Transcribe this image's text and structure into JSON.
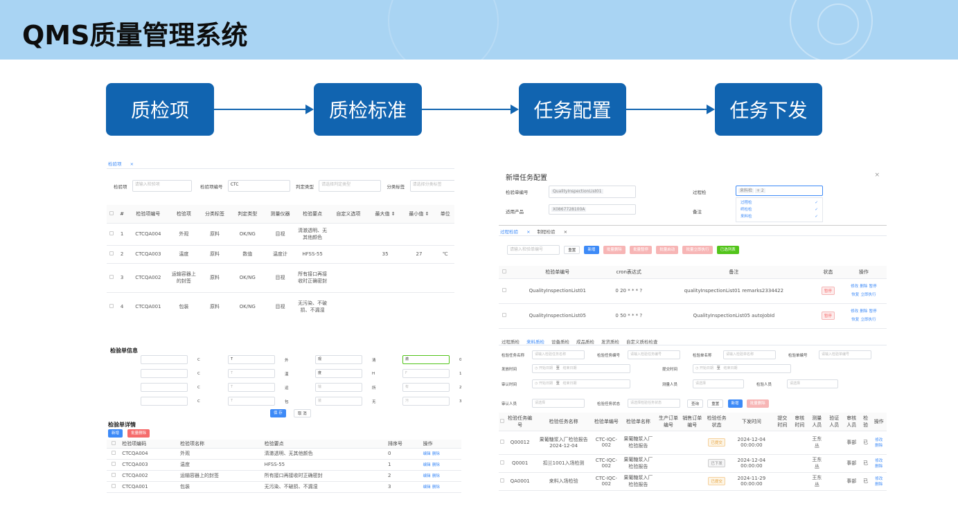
{
  "title": "QMS质量管理系统",
  "flow": [
    "质检项",
    "质检标准",
    "任务配置",
    "任务下发"
  ],
  "s1": {
    "tab": "检验项",
    "close": "×",
    "labels": [
      "检验项",
      "检验项编号",
      "判定类型",
      "分类标签"
    ],
    "placeholders": [
      "请输入检验项",
      "",
      "请选择判定类型",
      "请选择分类标签"
    ],
    "code_val": "CTC",
    "headers": [
      "",
      "#",
      "检验项编号",
      "检验项",
      "分类标签",
      "判定类型",
      "测量仪器",
      "检验要点",
      "自定义选项",
      "最大值 ⇕",
      "最小值 ⇕",
      "单位"
    ],
    "rows": [
      [
        "",
        "1",
        "CTCQA004",
        "外观",
        "原料",
        "OK/NG",
        "目视",
        "清澈透明、无其他颜色",
        "",
        "",
        "",
        ""
      ],
      [
        "",
        "2",
        "CTCQA003",
        "温度",
        "原料",
        "数值",
        "温度计",
        "HFSS-55",
        "",
        "35",
        "27",
        "℃"
      ],
      [
        "",
        "3",
        "CTCQA002",
        "运输容器上的封签",
        "原料",
        "OK/NG",
        "目视",
        "所有接口再接收时正确密封",
        "",
        "",
        "",
        ""
      ],
      [
        "",
        "4",
        "CTCQA001",
        "包装",
        "原料",
        "OK/NG",
        "目视",
        "无污染、不破损、不漏湿",
        "",
        "",
        "",
        ""
      ]
    ]
  },
  "s2": {
    "title": "新增任务配置",
    "close": "×",
    "f1l": "检验单编号",
    "f1v": "QualityInspectionList01",
    "f2l": "适用产品",
    "f2v": "X0867728100A",
    "f3l": "过程检",
    "f3v": "来料检",
    "f3n": "+ 2",
    "f4l": "备注",
    "options": [
      "过程检",
      "终检检",
      "来料检"
    ],
    "tabs": [
      "过程检验",
      "制程检验"
    ],
    "search_ph": "请输入检验单编号",
    "btns": [
      "重置",
      "新增",
      "批量删除",
      "批量暂停",
      "批量启动",
      "批量立即执行",
      "已选列表"
    ],
    "headers": [
      "",
      "检验单编号",
      "cron表达式",
      "备注",
      "状态",
      "操作"
    ],
    "rows": [
      [
        "",
        "QualityInspectionList01",
        "0 20 * * * ?",
        "qualityInspectionList01 remarks2334422",
        "暂停"
      ],
      [
        "",
        "QualityInspectionList05",
        "0 50 * * * ?",
        "QualityInspectionList05 autoJobId",
        "暂停"
      ]
    ],
    "ops1": [
      "修改",
      "删除",
      "暂停"
    ],
    "ops2": [
      "恢复",
      "立即执行"
    ]
  },
  "s3": {
    "title": "检验单信息",
    "rows": [
      [
        "",
        "CTCQA004",
        "外观",
        "清澈透明、无其他颜色",
        "0"
      ],
      [
        "",
        "CTCQA003",
        "温度",
        "HFSS-55",
        "1"
      ],
      [
        "",
        "CTCQA002",
        "运输容器上的封签",
        "所有接口再接收时正确密封",
        "2"
      ],
      [
        "",
        "CTCQA001",
        "包装",
        "无污染、不破损、不漏湿",
        "3"
      ]
    ],
    "save": "保 存",
    "cancel": "取 消",
    "detail_title": "检验单详情",
    "add": "新增",
    "bulk": "批量删除",
    "headers": [
      "",
      "检验项编码",
      "检验项名称",
      "检验要点",
      "排序号",
      "操作"
    ],
    "ops": [
      "编辑",
      "删除"
    ]
  },
  "s4": {
    "tabs": [
      "过程质检",
      "来料质检",
      "设备质检",
      "成品质检",
      "发货质检",
      "自定义质检检查"
    ],
    "f": [
      [
        "检验任务名称",
        "请输入检验任务名称"
      ],
      [
        "检验任务编号",
        "请输入检验任务编号"
      ],
      [
        "检验单名称",
        "请输入检验单名称"
      ],
      [
        "检验单编号",
        "请输入检验单编号"
      ]
    ],
    "dates": [
      [
        "发放时间",
        "开始日期",
        "至",
        "结束日期"
      ],
      [
        "提交时间",
        "开始日期",
        "至",
        "结束日期"
      ],
      [
        "审认时间",
        "开始日期",
        "至",
        "结束日期"
      ]
    ],
    "sel": [
      [
        "测量人员",
        "请选择"
      ],
      [
        "检验人员",
        "请选择"
      ],
      [
        "审认人员",
        "请选择"
      ],
      [
        "检验任务状态",
        "请选择检验任务状态"
      ]
    ],
    "btns": [
      "查询",
      "重置",
      "新增",
      "批量删除"
    ],
    "headers": [
      "",
      "检验任务编号",
      "检验任务名称",
      "检验单编号",
      "检验单名称",
      "生产订单编号",
      "销售订单编号",
      "检验任务状态",
      "下发时间",
      "提交时间",
      "审核时间",
      "测量人员",
      "验证人员",
      "审核人员",
      "检验",
      "操作"
    ],
    "rows": [
      [
        "",
        "Q00012",
        "果葡糖浆入厂检验报告2024-12-04",
        "CTC-IQC-002",
        "果葡糖浆入厂检验报告",
        "",
        "",
        "已提交",
        "2024-12-04 00:00:00",
        "",
        "",
        "王东丛",
        "",
        "事部",
        "已"
      ],
      [
        "",
        "Q0001",
        "扣兰1001入场检测",
        "CTC-IQC-002",
        "果葡糖浆入厂检验报告",
        "",
        "",
        "已下发",
        "2024-12-04 00:00:00",
        "",
        "",
        "王东丛",
        "",
        "事部",
        "已"
      ],
      [
        "",
        "QA0001",
        "来料入场检验",
        "CTC-IQC-002",
        "果葡糖浆入厂检验报告",
        "",
        "",
        "已提交",
        "2024-11-29 00:00:00",
        "",
        "",
        "王东丛",
        "",
        "事部",
        "已"
      ]
    ],
    "ops": [
      "修改",
      "删除"
    ]
  }
}
